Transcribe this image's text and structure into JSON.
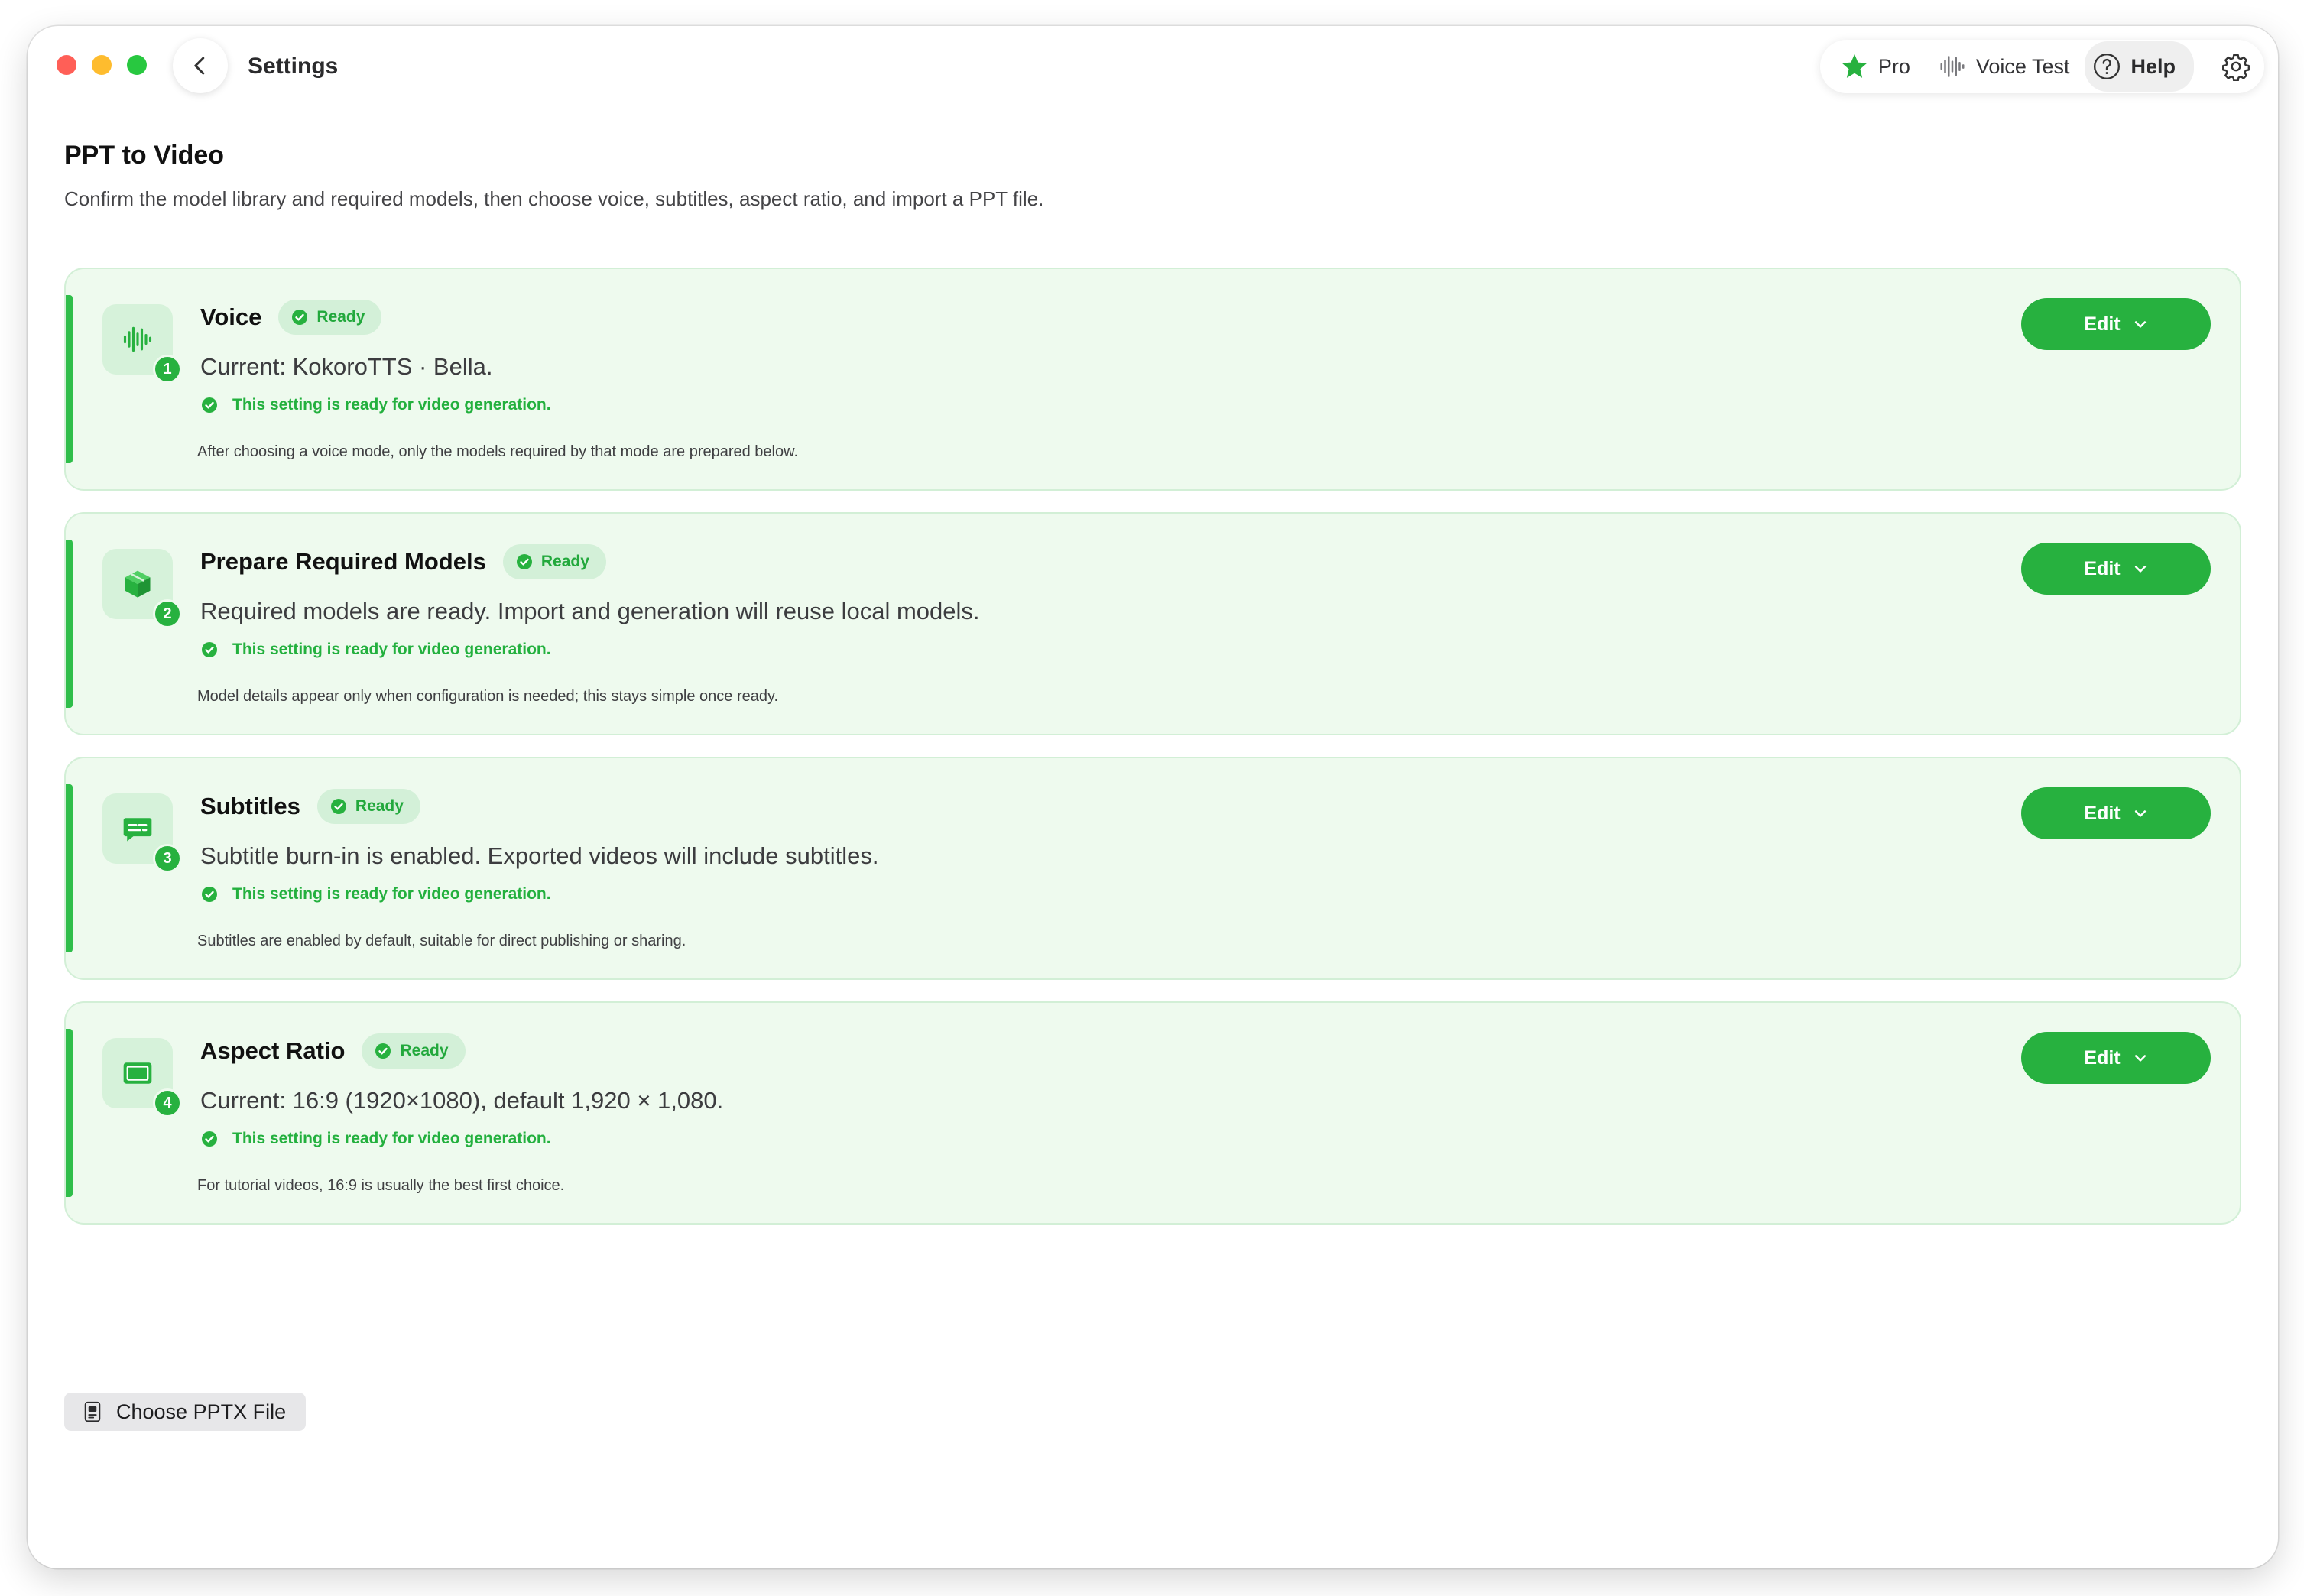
{
  "window": {
    "title": "Settings"
  },
  "toolbar": {
    "pro_label": "Pro",
    "voice_test_label": "Voice Test",
    "help_label": "Help"
  },
  "page": {
    "title": "PPT to Video",
    "subtitle": "Confirm the model library and required models, then choose voice, subtitles, aspect ratio, and import a PPT file."
  },
  "cards": [
    {
      "number": "1",
      "icon": "waveform-icon",
      "title": "Voice",
      "badge": "Ready",
      "current": "Current: KokoroTTS · Bella.",
      "status": "This setting is ready for video generation.",
      "note": "After choosing a voice mode, only the models required by that mode are prepared below.",
      "button": "Edit"
    },
    {
      "number": "2",
      "icon": "cube-icon",
      "title": "Prepare Required Models",
      "badge": "Ready",
      "current": "Required models are ready. Import and generation will reuse local models.",
      "status": "This setting is ready for video generation.",
      "note": "Model details appear only when configuration is needed; this stays simple once ready.",
      "button": "Edit"
    },
    {
      "number": "3",
      "icon": "caption-bubble-icon",
      "title": "Subtitles",
      "badge": "Ready",
      "current": "Subtitle burn-in is enabled. Exported videos will include subtitles.",
      "status": "This setting is ready for video generation.",
      "note": "Subtitles are enabled by default, suitable for direct publishing or sharing.",
      "button": "Edit"
    },
    {
      "number": "4",
      "icon": "aspect-rectangle-icon",
      "title": "Aspect Ratio",
      "badge": "Ready",
      "current": "Current: 16:9 (1920×1080), default 1,920 × 1,080.",
      "status": "This setting is ready for video generation.",
      "note": "For tutorial videos, 16:9 is usually the best first choice.",
      "button": "Edit"
    }
  ],
  "file_button": {
    "label": "Choose PPTX File"
  },
  "colors": {
    "accent": "#27b13f",
    "card_background": "#eefaee",
    "card_border": "#d2efd6",
    "badge_background": "#d3f0d8"
  }
}
